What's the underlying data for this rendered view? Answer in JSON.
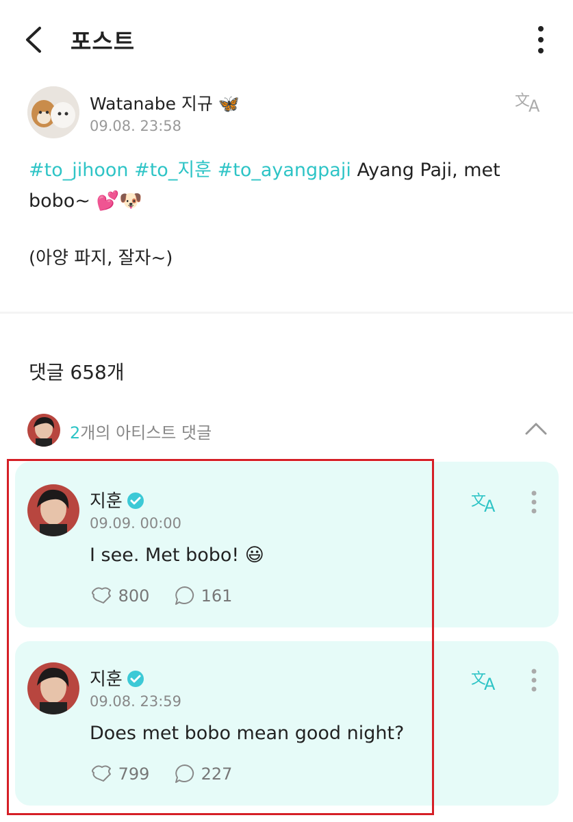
{
  "header": {
    "title": "포스트"
  },
  "post": {
    "author": "Watanabe 지규 🦋",
    "date": "09.08. 23:58",
    "hashtags": [
      "#to_jihoon",
      "#to_지훈",
      "#to_ayangpaji"
    ],
    "text_line1": "Ayang Paji, met",
    "text_line2": "bobo~ 💕🐶",
    "text_sub": "(아양 파지, 잘자~)"
  },
  "comments": {
    "count_label": "댓글 658개",
    "artist_count": "2",
    "artist_label": "개의 아티스트 댓글"
  },
  "artist_comments": [
    {
      "name": "지훈",
      "date": "09.09. 00:00",
      "text": "I see. Met bobo! 😃",
      "likes": "800",
      "replies": "161"
    },
    {
      "name": "지훈",
      "date": "09.08. 23:59",
      "text": "Does met bobo mean good night?",
      "likes": "799",
      "replies": "227"
    }
  ],
  "colors": {
    "accent": "#2ec4c6",
    "card_bg": "#e6fbf8",
    "highlight": "#d51f26"
  }
}
